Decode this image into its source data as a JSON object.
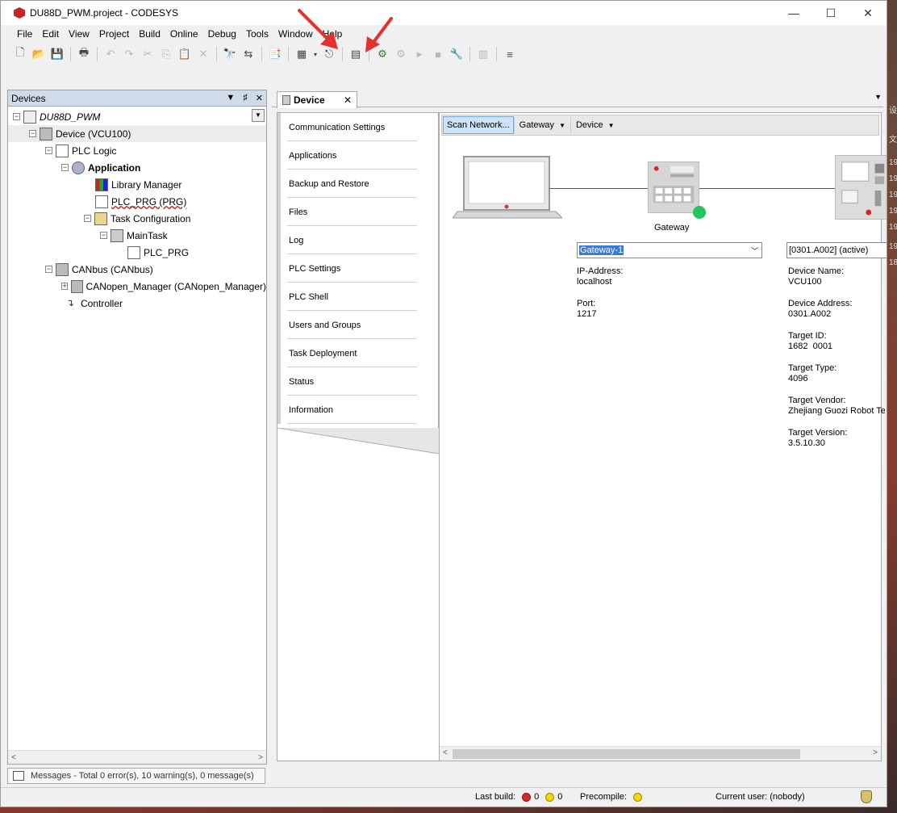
{
  "window": {
    "title": "DU88D_PWM.project - CODESYS",
    "minimize": "—",
    "maximize": "☐",
    "close": "✕"
  },
  "menu": [
    "File",
    "Edit",
    "View",
    "Project",
    "Build",
    "Online",
    "Debug",
    "Tools",
    "Window",
    "Help"
  ],
  "devices_panel": {
    "title": "Devices",
    "buttons": [
      "▼",
      "♯",
      "✕"
    ],
    "tree": [
      {
        "label": "DU88D_PWM",
        "level": 0,
        "style": "italic"
      },
      {
        "label": "Device (VCU100)",
        "level": 1
      },
      {
        "label": "PLC Logic",
        "level": 2
      },
      {
        "label": "Application",
        "level": 3,
        "style": "bold"
      },
      {
        "label": "Library Manager",
        "level": 4
      },
      {
        "label": "PLC_PRG (PRG)",
        "level": 4,
        "style": "wavy"
      },
      {
        "label": "Task Configuration",
        "level": 4
      },
      {
        "label": "MainTask",
        "level": 5
      },
      {
        "label": "PLC_PRG",
        "level": 6
      },
      {
        "label": "CANbus (CANbus)",
        "level": 2
      },
      {
        "label": "CANopen_Manager (CANopen_Manager)",
        "level": 3
      },
      {
        "label": "Controller",
        "level": 2
      }
    ]
  },
  "editor": {
    "tab_label": "Device",
    "nav_items": [
      "Communication Settings",
      "Applications",
      "Backup and Restore",
      "Files",
      "Log",
      "PLC Settings",
      "PLC Shell",
      "Users and Groups",
      "Task Deployment",
      "Status",
      "Information"
    ],
    "toolbar": {
      "scan_button": "Scan Network...",
      "gateway_menu": "Gateway",
      "device_menu": "Device"
    },
    "gateway": {
      "label": "Gateway",
      "select_value": "Gateway-1",
      "ip_label": "IP-Address:",
      "ip_value": "localhost",
      "port_label": "Port:",
      "port_value": "1217"
    },
    "device": {
      "select_value": "[0301.A002] (active)",
      "name_label": "Device Name:",
      "name_value": "VCU100",
      "address_label": "Device Address:",
      "address_value": "0301.A002",
      "target_id_label": "Target ID:",
      "target_id_value": "1682  0001",
      "target_type_label": "Target Type:",
      "target_type_value": "4096",
      "vendor_label": "Target Vendor:",
      "vendor_value": "Zhejiang Guozi Robot Te",
      "version_label": "Target Version:",
      "version_value": "3.5.10.30"
    }
  },
  "messages": {
    "text": "Messages - Total 0 error(s), 10 warning(s), 0 message(s)"
  },
  "statusbar": {
    "last_build_label": "Last build:",
    "errors": "0",
    "warnings": "0",
    "precompile_label": "Precompile:",
    "current_user": "Current user: (nobody)"
  },
  "colors": {
    "accent_arrow": "#e53030",
    "online_green": "#22c55e",
    "selection_blue": "#3a7bd5"
  }
}
